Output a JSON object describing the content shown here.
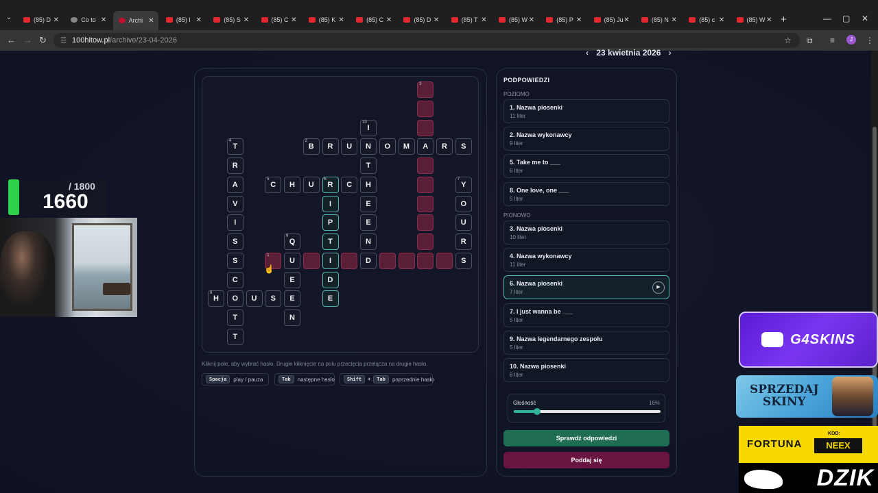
{
  "browser": {
    "tabs": [
      {
        "label": "(85) D",
        "icon": "youtube-icon"
      },
      {
        "label": "Co to",
        "icon": "globe-icon"
      },
      {
        "label": "Archi",
        "icon": "archive-icon",
        "active": true
      },
      {
        "label": "(85) I",
        "icon": "youtube-icon"
      },
      {
        "label": "(85) S",
        "icon": "youtube-icon"
      },
      {
        "label": "(85) C",
        "icon": "youtube-icon"
      },
      {
        "label": "(85) K",
        "icon": "youtube-icon"
      },
      {
        "label": "(85) C",
        "icon": "youtube-icon"
      },
      {
        "label": "(85) D",
        "icon": "youtube-icon"
      },
      {
        "label": "(85) T",
        "icon": "youtube-icon"
      },
      {
        "label": "(85) W",
        "icon": "youtube-icon"
      },
      {
        "label": "(85) P",
        "icon": "youtube-icon"
      },
      {
        "label": "(85) Ju",
        "icon": "youtube-icon"
      },
      {
        "label": "(85) N",
        "icon": "youtube-icon"
      },
      {
        "label": "(85) c",
        "icon": "youtube-icon"
      },
      {
        "label": "(85) W",
        "icon": "youtube-icon"
      }
    ],
    "url_host": "100hitow.pl",
    "url_path": "/archive/23-04-2026",
    "profile_initial": "J"
  },
  "header": {
    "date": "23 kwietnia 2026",
    "prev": "‹",
    "next": "›"
  },
  "crossword": {
    "hint": "Kliknij pole, aby wybrać hasło. Drugie kliknięcie na polu przecięcia przełącza na drugie hasło.",
    "shortcuts": {
      "space_key": "Spacja",
      "space_action": "play / pauza",
      "tab_key": "Tab",
      "tab_action": "następne hasło",
      "shift_key": "Shift",
      "plus": "+",
      "shift_tab_key": "Tab",
      "shift_tab_action": "poprzednie hasło"
    },
    "cells": [
      {
        "r": 0,
        "c": 11,
        "l": "",
        "n": "3",
        "s": "pink"
      },
      {
        "r": 1,
        "c": 11,
        "l": "",
        "s": "pink"
      },
      {
        "r": 2,
        "c": 8,
        "l": "I",
        "n": "10"
      },
      {
        "r": 2,
        "c": 11,
        "l": "",
        "s": "pink"
      },
      {
        "r": 3,
        "c": 1,
        "l": "T",
        "n": "4"
      },
      {
        "r": 3,
        "c": 5,
        "l": "B",
        "n": "2"
      },
      {
        "r": 3,
        "c": 6,
        "l": "R"
      },
      {
        "r": 3,
        "c": 7,
        "l": "U"
      },
      {
        "r": 3,
        "c": 8,
        "l": "N"
      },
      {
        "r": 3,
        "c": 9,
        "l": "O"
      },
      {
        "r": 3,
        "c": 10,
        "l": "M"
      },
      {
        "r": 3,
        "c": 11,
        "l": "A"
      },
      {
        "r": 3,
        "c": 12,
        "l": "R"
      },
      {
        "r": 3,
        "c": 13,
        "l": "S"
      },
      {
        "r": 4,
        "c": 1,
        "l": "R"
      },
      {
        "r": 4,
        "c": 8,
        "l": "T"
      },
      {
        "r": 4,
        "c": 11,
        "l": "",
        "s": "pink"
      },
      {
        "r": 5,
        "c": 1,
        "l": "A"
      },
      {
        "r": 5,
        "c": 3,
        "l": "C",
        "n": "5"
      },
      {
        "r": 5,
        "c": 4,
        "l": "H"
      },
      {
        "r": 5,
        "c": 5,
        "l": "U"
      },
      {
        "r": 5,
        "c": 6,
        "l": "R",
        "n": "6",
        "s": "teal"
      },
      {
        "r": 5,
        "c": 7,
        "l": "C"
      },
      {
        "r": 5,
        "c": 8,
        "l": "H"
      },
      {
        "r": 5,
        "c": 11,
        "l": "",
        "s": "pink"
      },
      {
        "r": 5,
        "c": 13,
        "l": "Y",
        "n": "7"
      },
      {
        "r": 6,
        "c": 1,
        "l": "V"
      },
      {
        "r": 6,
        "c": 6,
        "l": "I",
        "s": "teal"
      },
      {
        "r": 6,
        "c": 8,
        "l": "E"
      },
      {
        "r": 6,
        "c": 11,
        "l": "",
        "s": "pink"
      },
      {
        "r": 6,
        "c": 13,
        "l": "O"
      },
      {
        "r": 7,
        "c": 1,
        "l": "I"
      },
      {
        "r": 7,
        "c": 6,
        "l": "P",
        "s": "teal"
      },
      {
        "r": 7,
        "c": 8,
        "l": "E"
      },
      {
        "r": 7,
        "c": 11,
        "l": "",
        "s": "pink"
      },
      {
        "r": 7,
        "c": 13,
        "l": "U"
      },
      {
        "r": 8,
        "c": 1,
        "l": "S"
      },
      {
        "r": 8,
        "c": 4,
        "l": "Q",
        "n": "9"
      },
      {
        "r": 8,
        "c": 6,
        "l": "T",
        "s": "teal"
      },
      {
        "r": 8,
        "c": 8,
        "l": "N"
      },
      {
        "r": 8,
        "c": 11,
        "l": "",
        "s": "pink"
      },
      {
        "r": 8,
        "c": 13,
        "l": "R"
      },
      {
        "r": 9,
        "c": 1,
        "l": "S"
      },
      {
        "r": 9,
        "c": 3,
        "l": "",
        "n": "1",
        "s": "pink"
      },
      {
        "r": 9,
        "c": 4,
        "l": "U"
      },
      {
        "r": 9,
        "c": 5,
        "l": "",
        "s": "pink"
      },
      {
        "r": 9,
        "c": 6,
        "l": "I",
        "s": "teal"
      },
      {
        "r": 9,
        "c": 7,
        "l": "",
        "s": "pink"
      },
      {
        "r": 9,
        "c": 8,
        "l": "D"
      },
      {
        "r": 9,
        "c": 9,
        "l": "",
        "s": "pink"
      },
      {
        "r": 9,
        "c": 10,
        "l": "",
        "s": "pink"
      },
      {
        "r": 9,
        "c": 11,
        "l": "",
        "s": "pink"
      },
      {
        "r": 9,
        "c": 12,
        "l": "",
        "s": "pink"
      },
      {
        "r": 9,
        "c": 13,
        "l": "S"
      },
      {
        "r": 10,
        "c": 1,
        "l": "C"
      },
      {
        "r": 10,
        "c": 4,
        "l": "E"
      },
      {
        "r": 10,
        "c": 6,
        "l": "D",
        "s": "teal"
      },
      {
        "r": 11,
        "c": 0,
        "l": "H",
        "n": "8"
      },
      {
        "r": 11,
        "c": 1,
        "l": "O"
      },
      {
        "r": 11,
        "c": 2,
        "l": "U"
      },
      {
        "r": 11,
        "c": 3,
        "l": "S"
      },
      {
        "r": 11,
        "c": 4,
        "l": "E"
      },
      {
        "r": 11,
        "c": 6,
        "l": "E",
        "s": "teal"
      },
      {
        "r": 12,
        "c": 1,
        "l": "T"
      },
      {
        "r": 12,
        "c": 4,
        "l": "N"
      },
      {
        "r": 13,
        "c": 1,
        "l": "T"
      }
    ]
  },
  "clues": {
    "title": "PODPOWIEDZI",
    "across_label": "POZIOMO",
    "down_label": "PIONOWO",
    "across": [
      {
        "text": "1. Nazwa piosenki",
        "len": "11 liter"
      },
      {
        "text": "2. Nazwa wykonawcy",
        "len": "9 liter"
      },
      {
        "text": "5. Take me to ___",
        "len": "6 liter"
      },
      {
        "text": "8. One love, one ___",
        "len": "5 liter"
      }
    ],
    "down": [
      {
        "text": "3. Nazwa piosenki",
        "len": "10 liter"
      },
      {
        "text": "4. Nazwa wykonawcy",
        "len": "11 liter"
      },
      {
        "text": "6. Nazwa piosenki",
        "len": "7 liter",
        "active": true
      },
      {
        "text": "7. I just wanna be ___",
        "len": "5 liter"
      },
      {
        "text": "9. Nazwa legendarnego zespołu",
        "len": "5 liter"
      },
      {
        "text": "10. Nazwa piosenki",
        "len": "8 liter"
      }
    ],
    "volume_label": "Głośność",
    "volume_value": "16%",
    "volume_fraction": 0.16,
    "check_button": "Sprawdź odpowiedzi",
    "give_up_button": "Poddaj się"
  },
  "overlay": {
    "score_max": "/ 1800",
    "score_current": "1660",
    "ad_g4": "G4SKINS",
    "ad_sprzedaj": "SPRZEDAJ\nSKINY",
    "ad_fortuna": "FORTUNA",
    "ad_fortuna_code_label": "KOD:",
    "ad_fortuna_code": "NEEX",
    "ad_dzik": "DZIK"
  }
}
